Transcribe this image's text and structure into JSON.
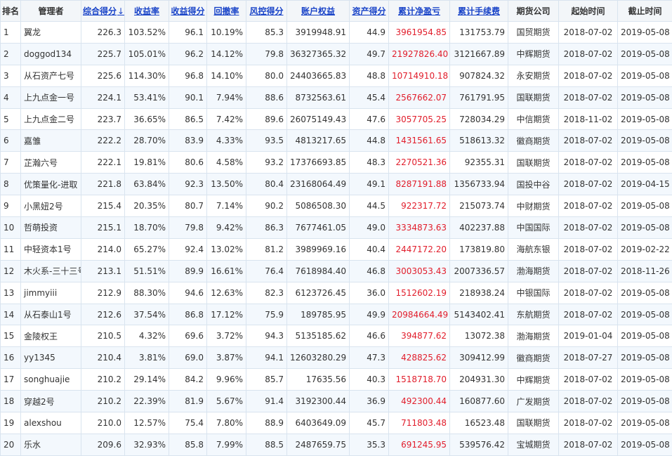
{
  "columns": [
    {
      "key": "rank",
      "label": "排名",
      "sortable": false
    },
    {
      "key": "manager",
      "label": "管理者",
      "sortable": false
    },
    {
      "key": "total_score",
      "label": "综合得分",
      "sortable": true,
      "sorted": true,
      "sort_marker": "↓"
    },
    {
      "key": "return_rate",
      "label": "收益率",
      "sortable": true
    },
    {
      "key": "return_score",
      "label": "收益得分",
      "sortable": true
    },
    {
      "key": "drawdown",
      "label": "回撤率",
      "sortable": true
    },
    {
      "key": "risk_score",
      "label": "风控得分",
      "sortable": true
    },
    {
      "key": "equity",
      "label": "账户权益",
      "sortable": true
    },
    {
      "key": "asset_score",
      "label": "资产得分",
      "sortable": true
    },
    {
      "key": "net_pnl",
      "label": "累计净盈亏",
      "sortable": true
    },
    {
      "key": "fees",
      "label": "累计手续费",
      "sortable": true
    },
    {
      "key": "broker",
      "label": "期货公司",
      "sortable": false
    },
    {
      "key": "start",
      "label": "起始时间",
      "sortable": false
    },
    {
      "key": "end",
      "label": "截止时间",
      "sortable": false
    }
  ],
  "rows": [
    [
      "1",
      "翼龙",
      "226.3",
      "103.52%",
      "96.1",
      "10.19%",
      "85.3",
      "3919948.91",
      "44.9",
      "3961954.85",
      "131753.79",
      "国贸期货",
      "2018-07-02",
      "2019-05-08"
    ],
    [
      "2",
      "doggod134",
      "225.7",
      "105.01%",
      "96.2",
      "14.12%",
      "79.8",
      "36327365.32",
      "49.7",
      "21927826.40",
      "3121667.89",
      "中辉期货",
      "2018-07-02",
      "2019-05-08"
    ],
    [
      "3",
      "从石资产七号",
      "225.6",
      "114.30%",
      "96.8",
      "14.10%",
      "80.0",
      "24403665.83",
      "48.8",
      "10714910.18",
      "907824.32",
      "永安期货",
      "2018-07-02",
      "2019-05-08"
    ],
    [
      "4",
      "上九点金一号",
      "224.1",
      "53.41%",
      "90.1",
      "7.94%",
      "88.6",
      "8732563.61",
      "45.4",
      "2567662.07",
      "761791.95",
      "国联期货",
      "2018-07-02",
      "2019-05-08"
    ],
    [
      "5",
      "上九点金二号",
      "223.7",
      "36.65%",
      "86.5",
      "7.42%",
      "89.6",
      "26075149.43",
      "47.6",
      "3057705.25",
      "728034.29",
      "中信期货",
      "2018-11-02",
      "2019-05-08"
    ],
    [
      "6",
      "嘉雏",
      "222.2",
      "28.70%",
      "83.9",
      "4.33%",
      "93.5",
      "4813217.65",
      "44.8",
      "1431561.65",
      "518613.32",
      "徽商期货",
      "2018-07-02",
      "2019-05-08"
    ],
    [
      "7",
      "芷瀚六号",
      "222.1",
      "19.81%",
      "80.6",
      "4.58%",
      "93.2",
      "17376693.85",
      "48.3",
      "2270521.36",
      "92355.31",
      "国联期货",
      "2018-07-02",
      "2019-05-08"
    ],
    [
      "8",
      "优策量化-进取",
      "221.8",
      "63.84%",
      "92.3",
      "13.50%",
      "80.4",
      "23168064.49",
      "49.1",
      "8287191.88",
      "1356733.94",
      "国投中谷",
      "2018-07-02",
      "2019-04-15"
    ],
    [
      "9",
      "小黑妞2号",
      "215.4",
      "20.35%",
      "80.7",
      "7.14%",
      "90.2",
      "5086508.30",
      "44.5",
      "922317.72",
      "215073.74",
      "中财期货",
      "2018-07-02",
      "2019-05-08"
    ],
    [
      "10",
      "哲萌投资",
      "215.1",
      "18.70%",
      "79.8",
      "9.42%",
      "86.3",
      "7677461.05",
      "49.0",
      "3334873.63",
      "402237.88",
      "中国国际",
      "2018-07-02",
      "2019-05-08"
    ],
    [
      "11",
      "中轻资本1号",
      "214.0",
      "65.27%",
      "92.4",
      "13.02%",
      "81.2",
      "3989969.16",
      "40.4",
      "2447172.20",
      "173819.80",
      "海航东银",
      "2018-07-02",
      "2019-02-22"
    ],
    [
      "12",
      "木火系-三十三号",
      "213.1",
      "51.51%",
      "89.9",
      "16.61%",
      "76.4",
      "7618984.40",
      "46.8",
      "3003053.43",
      "2007336.57",
      "渤海期货",
      "2018-07-02",
      "2018-11-26"
    ],
    [
      "13",
      "jimmyiii",
      "212.9",
      "88.30%",
      "94.6",
      "12.63%",
      "82.3",
      "6123726.45",
      "36.0",
      "1512602.19",
      "218938.24",
      "中银国际",
      "2018-07-02",
      "2019-05-08"
    ],
    [
      "14",
      "从石泰山1号",
      "212.6",
      "37.54%",
      "86.8",
      "17.12%",
      "75.9",
      "189785.95",
      "49.9",
      "20984664.49",
      "5143402.41",
      "东航期货",
      "2018-07-02",
      "2019-05-08"
    ],
    [
      "15",
      "金陵权王",
      "210.5",
      "4.32%",
      "69.6",
      "3.72%",
      "94.3",
      "5135185.62",
      "46.6",
      "394877.62",
      "13072.38",
      "渤海期货",
      "2019-01-04",
      "2019-05-08"
    ],
    [
      "16",
      "yy1345",
      "210.4",
      "3.81%",
      "69.0",
      "3.87%",
      "94.1",
      "12603280.29",
      "47.3",
      "428825.62",
      "309412.99",
      "徽商期货",
      "2018-07-27",
      "2019-05-08"
    ],
    [
      "17",
      "songhuajie",
      "210.2",
      "29.14%",
      "84.2",
      "9.96%",
      "85.7",
      "17635.56",
      "40.3",
      "1518718.70",
      "204931.30",
      "中辉期货",
      "2018-07-02",
      "2019-05-08"
    ],
    [
      "18",
      "穿越2号",
      "210.2",
      "22.39%",
      "81.9",
      "5.67%",
      "91.4",
      "3192300.44",
      "36.9",
      "492300.44",
      "160877.60",
      "广发期货",
      "2018-07-02",
      "2019-05-08"
    ],
    [
      "19",
      "alexshou",
      "210.0",
      "12.57%",
      "75.4",
      "7.80%",
      "88.9",
      "6403649.09",
      "45.7",
      "711803.48",
      "16523.48",
      "国联期货",
      "2018-07-02",
      "2019-05-08"
    ],
    [
      "20",
      "乐水",
      "209.6",
      "32.93%",
      "85.8",
      "7.99%",
      "88.5",
      "2487659.75",
      "35.3",
      "691245.95",
      "539576.42",
      "宝城期货",
      "2018-07-02",
      "2019-05-08"
    ]
  ],
  "colors": {
    "header_bg": "#f3f6f9",
    "link": "#1a44c8",
    "pnl": "#e11d2b",
    "border": "#d9e4ef",
    "stripe": "#f3f8fd"
  }
}
